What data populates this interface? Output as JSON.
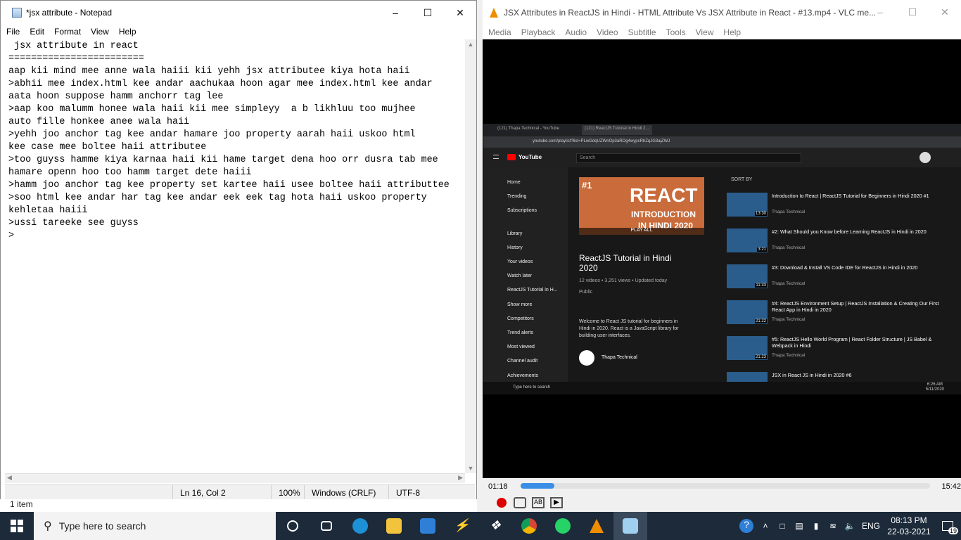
{
  "notepad": {
    "title": "*jsx attribute - Notepad",
    "menu": [
      "File",
      "Edit",
      "Format",
      "View",
      "Help"
    ],
    "lines": [
      " jsx attribute in react",
      "========================",
      "aap kii mind mee anne wala haiii kii yehh jsx attributee kiya hota haii",
      ">abhii mee index.html kee andar aachukaa hoon agar mee index.html kee andar",
      "aata hoon suppose hamm anchorr tag lee",
      ">aap koo malumm honee wala haii kii mee simpleyy  a b likhluu too mujhee",
      "auto fille honkee anee wala haii",
      ">yehh joo anchor tag kee andar hamare joo property aarah haii uskoo html",
      "kee case mee boltee haii attributee",
      ">too guyss hamme kiya karnaa haii kii hame target dena hoo orr dusra tab mee",
      "hamare openn hoo too hamm target dete haiii",
      ">hamm joo anchor tag kee property set kartee haii usee boltee haii attributtee",
      ">soo html kee andar har tag kee andar eek eek tag hota haii uskoo property",
      "kehletaa haiii",
      ">ussi tareeke see guyss",
      ">"
    ],
    "status": {
      "position": "Ln 16, Col 2",
      "zoom": "100%",
      "line_ending": "Windows (CRLF)",
      "encoding": "UTF-8"
    },
    "explorer_status": "1 item"
  },
  "vlc": {
    "title": "JSX Attributes in ReactJS in Hindi - HTML Attribute Vs JSX Attribute in React  - #13.mp4 - VLC me...",
    "menu": [
      "Media",
      "Playback",
      "Audio",
      "Video",
      "Subtitle",
      "Tools",
      "View",
      "Help"
    ],
    "time_elapsed": "01:18",
    "time_total": "15:42",
    "progress": 0.083
  },
  "youtube": {
    "tabs": [
      "(121) Thapa Technical - YouTube",
      "(121) ReactJS Tutorial in Hindi 2..."
    ],
    "url": "youtube.com/playlist?list=PLwGdqUZWnOp3aROg4wypcRhZqJG3ajZWJ",
    "search_placeholder": "Search",
    "sidebar": [
      "Home",
      "Trending",
      "Subscriptions",
      "Library",
      "History",
      "Your videos",
      "Watch later",
      "ReactJS Tutorial in H...",
      "Show more",
      "Competitors",
      "Trend alerts",
      "Most viewed",
      "Channel audit",
      "Achievements"
    ],
    "playlist_title": "ReactJS Tutorial in Hindi 2020",
    "playlist_meta": "12 videos • 3,251 views • Updated today",
    "privacy": "Public",
    "play_all": "PLAY ALL",
    "description": "Welcome to React JS tutorial for beginners in Hindi in 2020. React is a JavaScript library for building user interfaces.",
    "channel": "Thapa Technical",
    "sort_by": "SORT BY",
    "thumb_badge": "#1",
    "thumb_big": "REACT",
    "thumb_sub1": "INTRODUCTION",
    "thumb_sub2": "IN HINDI 2020",
    "videos": [
      {
        "title": "Introduction to React | ReactJS Tutorial for Beginners in Hindi 2020 #1",
        "channel": "Thapa Technical",
        "duration": "13:30"
      },
      {
        "title": "#2: What Should you Know before Learning ReactJS in Hindi in 2020",
        "channel": "Thapa Technical",
        "duration": "3:21"
      },
      {
        "title": "#3: Download & Install VS Code IDE for ReactJS in Hindi in 2020",
        "channel": "Thapa Technical",
        "duration": "11:33"
      },
      {
        "title": "#4: ReactJS Environment Setup | ReactJS Installation & Creating Our First React App in Hindi in 2020",
        "channel": "Thapa Technical",
        "duration": "21:22"
      },
      {
        "title": "#5: ReactJS Hello World Program | React Folder Structure | JS Babel & Webpack in Hindi",
        "channel": "Thapa Technical",
        "duration": "21:23"
      },
      {
        "title": "JSX in React JS in Hindi in 2020 #6",
        "channel": "",
        "duration": ""
      }
    ],
    "inner_taskbar_search": "Type here to search",
    "inner_time": "6:26 AM",
    "inner_date": "5/11/2020"
  },
  "taskbar": {
    "search_placeholder": "Type here to search",
    "language": "ENG",
    "time": "08:13 PM",
    "date": "22-03-2021",
    "notification_count": "19"
  },
  "colors": {
    "taskbar_bg": "#1c2a3a",
    "vlc_progress": "#3a8ee6",
    "yt_red": "#ff0000"
  }
}
